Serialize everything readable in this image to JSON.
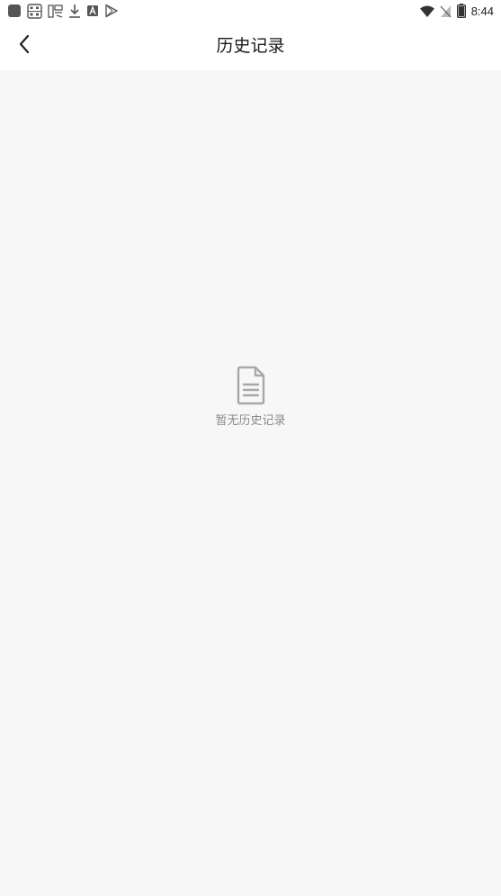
{
  "status_bar": {
    "time": "8:44",
    "left_icons": [
      "app-square-icon",
      "calendar-icon",
      "weather-icon",
      "download-icon",
      "a-badge-icon",
      "play-store-icon"
    ],
    "right_icons": [
      "wifi-icon",
      "no-sim-icon",
      "battery-icon"
    ]
  },
  "header": {
    "title": "历史记录",
    "back_icon": "chevron-left-icon"
  },
  "empty_state": {
    "icon": "document-icon",
    "message": "暂无历史记录"
  },
  "colors": {
    "background": "#f7f7f7",
    "header_bg": "#ffffff",
    "empty_text": "#8a8a8a",
    "empty_icon": "#a8a8a8"
  }
}
